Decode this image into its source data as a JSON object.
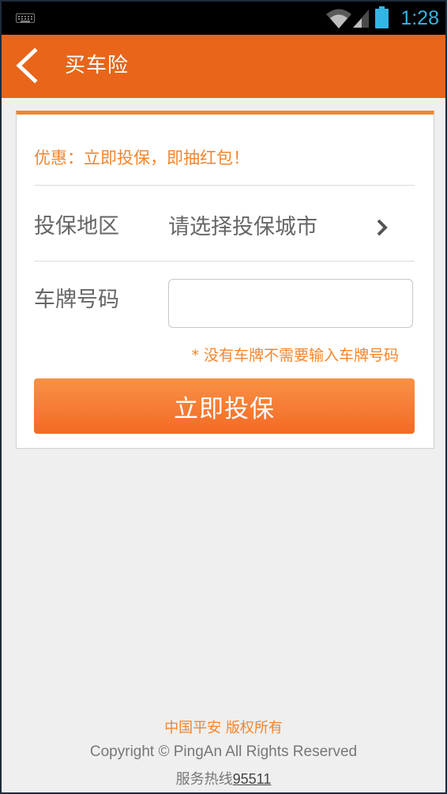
{
  "status_bar": {
    "time": "1:28",
    "icons": [
      "keyboard-icon",
      "wifi-icon",
      "signal-icon",
      "battery-icon"
    ],
    "clock_color": "#33b5e5"
  },
  "header": {
    "title": "买车险",
    "back_icon": "chevron-left-icon",
    "background": "#e8651a"
  },
  "form": {
    "promo": "优惠：立即投保，即抽红包！",
    "region_label": "投保地区",
    "region_value": "请选择投保城市",
    "plate_label": "车牌号码",
    "plate_value": "",
    "note": "* 没有车牌不需要输入车牌号码",
    "submit_label": "立即投保",
    "accent": "#f5852c"
  },
  "footer": {
    "brand": "中国平安 版权所有",
    "copyright": "Copyright © PingAn All Rights Reserved",
    "hotline_label": "服务热线",
    "hotline_number": "95511"
  }
}
